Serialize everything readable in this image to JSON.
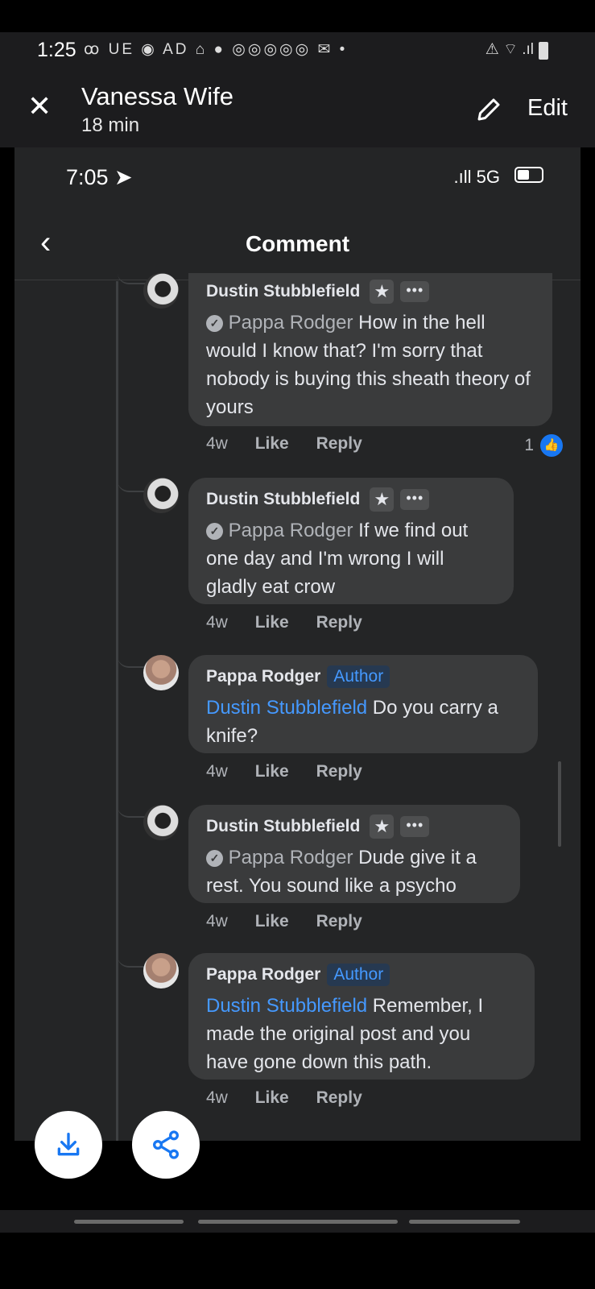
{
  "outer_status": {
    "time": "1:25",
    "left_icons": "ꝏ UE ◉ AD ⌂ ● ◎◎◎◎◎ ✉ •",
    "right_icons": "⚠ ⌔ .ıl"
  },
  "viewer": {
    "title": "Vanessa Wife",
    "subtitle": "18 min",
    "edit_label": "Edit"
  },
  "inner_status": {
    "time": "7:05 ➤",
    "signal": ".ıll 5G"
  },
  "header": {
    "title": "Comment"
  },
  "comments": [
    {
      "author": "Dustin Stubblefield",
      "mention": "Pappa Rodger",
      "text": "How in the hell would I know that? I'm sorry that nobody is buying this sheath theory of yours",
      "age": "4w",
      "like": "Like",
      "reply": "Reply",
      "reactions": "1"
    },
    {
      "author": "Dustin Stubblefield",
      "mention": "Pappa Rodger",
      "text": "If we find out one day and I'm wrong I will gladly eat crow",
      "age": "4w",
      "like": "Like",
      "reply": "Reply"
    },
    {
      "author": "Pappa Rodger",
      "badge": "Author",
      "mention": "Dustin Stubblefield",
      "text": "Do you carry a knife?",
      "age": "4w",
      "like": "Like",
      "reply": "Reply"
    },
    {
      "author": "Dustin Stubblefield",
      "mention": "Pappa Rodger",
      "text": "Dude give it a rest. You sound like a psycho",
      "age": "4w",
      "like": "Like",
      "reply": "Reply"
    },
    {
      "author": "Pappa Rodger",
      "badge": "Author",
      "mention": "Dustin Stubblefield",
      "text": "Remember, I made the original post and you have gone down this path.",
      "age": "4w",
      "like": "Like",
      "reply": "Reply"
    }
  ],
  "colors": {
    "background": "#242526",
    "bubble": "#3a3b3c",
    "link": "#4599ff",
    "like_blue": "#1877f2"
  }
}
